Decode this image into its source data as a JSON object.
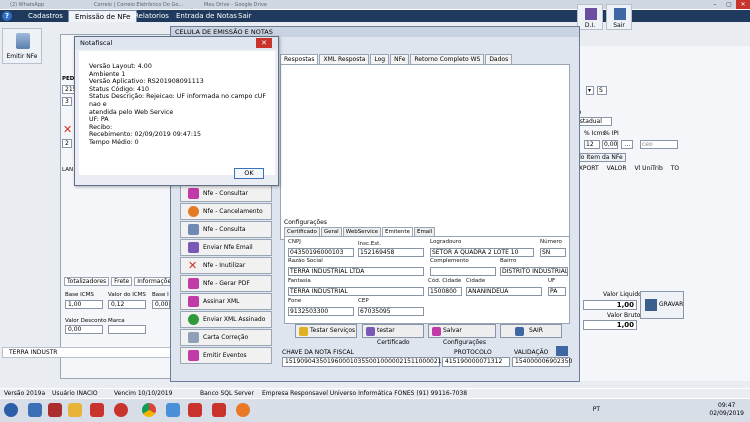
{
  "browser_tabs": [
    "(2) WhatsApp",
    "Correio | Correio Eletrônico Do Go...",
    "Meu Drive - Google Drive"
  ],
  "menu": {
    "items": [
      "Cadastros",
      "Emissão de NFe",
      "Relatorios",
      "Entrada de Notas",
      "Sair"
    ],
    "active": "Emissão de NFe"
  },
  "toolbar": {
    "emitir_label": "Emitir NFe"
  },
  "main_right": {
    "di_label": "D.I.",
    "sair_label": "Sair",
    "s_label": "S",
    "tributacao": "Estadual",
    "aliq_label": "ão",
    "icms_label": "% Icms",
    "ipi_label": "% IPI",
    "icms_value": "12",
    "ipi_value": "0,00",
    "item_label": "do Item da NFe",
    "grid_headers": [
      "EXPORT",
      "VALOR",
      "Vl UniTrib",
      "TO"
    ]
  },
  "main_left": {
    "pedido_label": "PED",
    "pedido_value": "215",
    "lan_label": "LAN",
    "bottom_tabs": [
      "Totalizadores",
      "Frete",
      "Informações Co"
    ],
    "base_icms_label": "Base ICMS",
    "base_icms_value": "1,00",
    "valor_icms_label": "Valor do ICMS",
    "valor_icms_value": "0,12",
    "base_i_label": "Base I",
    "base_i_value": "0,00",
    "valor_desconto_label": "Valor Desconto",
    "valor_desconto_value": "0,00",
    "marca_label": "Marca",
    "terra_row": "TERRA INDUSTR"
  },
  "totals": {
    "valor_liquido_label": "Valor Liquido",
    "valor_liquido": "1,00",
    "valor_bruto_label": "Valor Bruto",
    "valor_bruto": "1,00",
    "gravar_label": "GRAVAR"
  },
  "celula": {
    "title": "CELULA DE EMISSÃO E NOTAS",
    "tabs": [
      "Respostas",
      "XML Resposta",
      "Log",
      "NFe",
      "Retorno Completo WS",
      "Dados"
    ],
    "active_tab": "Respostas",
    "side_buttons": [
      "Nfe - Consultar",
      "Nfe - Cancelamento",
      "Nfe - Consulta Cadastro",
      "Enviar Nfe Email",
      "Nfe - Inutilizar",
      "Nfe - Gerar PDF",
      "Assinar XML",
      "Enviar XML Assinado",
      "Carta Correção",
      "Emitir Eventos"
    ],
    "config_label": "Configurações",
    "config_tabs": [
      "Certificado",
      "Geral",
      "WebService",
      "Emitente",
      "Email"
    ],
    "config_active": "Emitente",
    "fields": {
      "cnpj_label": "CNPJ",
      "cnpj": "04350196000103",
      "ie_label": "Insc.Est.",
      "ie": "152169458",
      "logradouro_label": "Logradouro",
      "logradouro": "SETOR A QUADRA 2 LOTE 10",
      "numero_label": "Número",
      "numero": "SN",
      "razao_label": "Razão Social",
      "razao": "TERRA INDUSTRIAL LTDA",
      "complemento_label": "Complemento",
      "complemento": "",
      "bairro_label": "Bairro",
      "bairro": "DISTRITO INDUSTRIAL",
      "fantasia_label": "Fantasia",
      "fantasia": "TERRA INDUSTRIAL",
      "cod_cidade_label": "Cód. Cidade",
      "cod_cidade": "1500800",
      "cidade_label": "Cidade",
      "cidade": "ANANINDEUA",
      "uf_label": "UF",
      "uf": "PA",
      "fone_label": "Fone",
      "fone": "9132503300",
      "cep_label": "CEP",
      "cep": "67035095"
    },
    "buttons": [
      "Testar Serviços",
      "testar Certificado",
      "Salvar Configurações",
      "SAIR"
    ],
    "chave_label": "CHAVE DA NOTA FISCAL",
    "chave": "15190904350196000103550010000021511000021510",
    "protocolo_label": "PROTOCOLO",
    "protocolo": "415190000071312",
    "validacao_label": "VALIDAÇÃO",
    "validacao": "154000006902350"
  },
  "dialog": {
    "title": "Notafiscal",
    "lines": [
      "Versão Layout: 4.00",
      "Ambiente 1",
      "Versão Aplicativo: RS201908091113",
      "Status Código: 410",
      "Status Descrição: Rejeicao: UF informada no campo cUF nao e",
      "atendida pelo Web Service",
      "UF: PA",
      "Recibo:",
      "Recebimento: 02/09/2019 09:47:15",
      "Tempo Médio: 0"
    ],
    "ok_label": "OK"
  },
  "status_bar": {
    "versao": "Versão  2019a",
    "usuario": "Usuário  INACIO",
    "vencim": "Vencim  10/10/2019",
    "banco": "Banco  SQL Server",
    "empresa": "Empresa Responsavel  Universo Informática FONES (91) 99116-7038"
  },
  "taskbar": {
    "lang": "PT",
    "time": "09:47",
    "date": "02/09/2019"
  }
}
